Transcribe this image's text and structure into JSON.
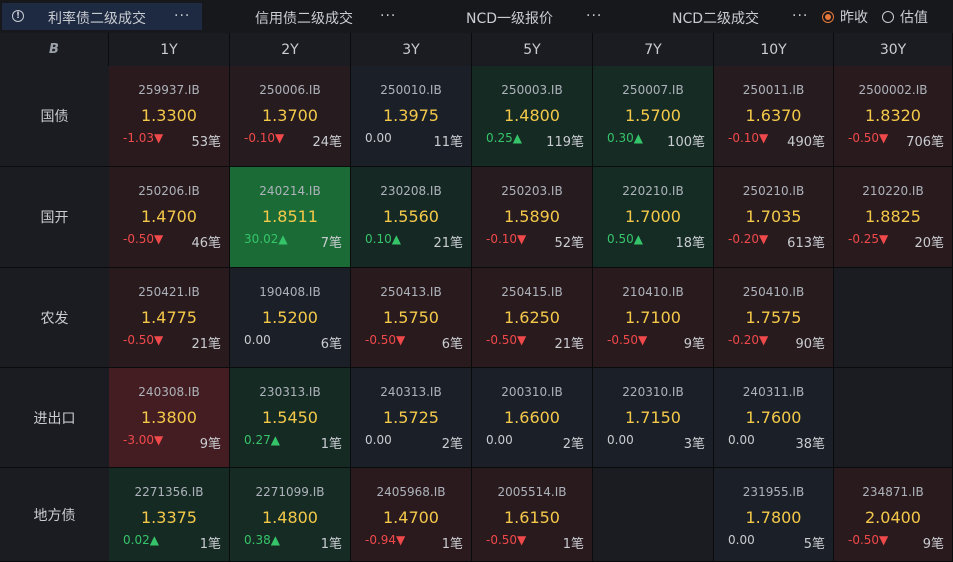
{
  "tabs": [
    {
      "label": "利率债二级成交",
      "more": "···",
      "active": true
    },
    {
      "label": "信用债二级成交",
      "more": "···",
      "active": false
    },
    {
      "label": "NCD一级报价",
      "more": "···",
      "active": false
    },
    {
      "label": "NCD二级成交",
      "more": "···",
      "active": false
    }
  ],
  "radio_options": [
    {
      "label": "昨收",
      "checked": true
    },
    {
      "label": "估值",
      "checked": false
    }
  ],
  "corner_icon": "B",
  "columns": [
    "1Y",
    "2Y",
    "3Y",
    "5Y",
    "7Y",
    "10Y",
    "30Y"
  ],
  "rows": [
    {
      "label": "国债",
      "cells": [
        {
          "code": "259937.IB",
          "yield": "1.3300",
          "change": "-1.03▼",
          "dir": "down",
          "count": "53笔",
          "bg": "#2a1a1d"
        },
        {
          "code": "250006.IB",
          "yield": "1.3700",
          "change": "-0.10▼",
          "dir": "down",
          "count": "24笔",
          "bg": "#261b1e"
        },
        {
          "code": "250010.IB",
          "yield": "1.3975",
          "change": "0.00",
          "dir": "flat",
          "count": "11笔",
          "bg": "#1b1f27"
        },
        {
          "code": "250003.IB",
          "yield": "1.4800",
          "change": "0.25▲",
          "dir": "up",
          "count": "119笔",
          "bg": "#152a23"
        },
        {
          "code": "250007.IB",
          "yield": "1.5700",
          "change": "0.30▲",
          "dir": "up",
          "count": "100笔",
          "bg": "#152b23"
        },
        {
          "code": "250011.IB",
          "yield": "1.6370",
          "change": "-0.10▼",
          "dir": "down",
          "count": "490笔",
          "bg": "#261b1e"
        },
        {
          "code": "2500002.IB",
          "yield": "1.8320",
          "change": "-0.50▼",
          "dir": "down",
          "count": "706笔",
          "bg": "#291a1d"
        }
      ]
    },
    {
      "label": "国开",
      "cells": [
        {
          "code": "250206.IB",
          "yield": "1.4700",
          "change": "-0.50▼",
          "dir": "down",
          "count": "46笔",
          "bg": "#291a1d"
        },
        {
          "code": "240214.IB",
          "yield": "1.8511",
          "change": "30.02▲",
          "dir": "up",
          "count": "7笔",
          "bg": "#1a6b35"
        },
        {
          "code": "230208.IB",
          "yield": "1.5560",
          "change": "0.10▲",
          "dir": "up",
          "count": "21笔",
          "bg": "#152823"
        },
        {
          "code": "250203.IB",
          "yield": "1.5890",
          "change": "-0.10▼",
          "dir": "down",
          "count": "52笔",
          "bg": "#261b1e"
        },
        {
          "code": "220210.IB",
          "yield": "1.7000",
          "change": "0.50▲",
          "dir": "up",
          "count": "18笔",
          "bg": "#152c24"
        },
        {
          "code": "250210.IB",
          "yield": "1.7035",
          "change": "-0.20▼",
          "dir": "down",
          "count": "613笔",
          "bg": "#271b1e"
        },
        {
          "code": "210220.IB",
          "yield": "1.8825",
          "change": "-0.25▼",
          "dir": "down",
          "count": "20笔",
          "bg": "#281a1d"
        }
      ]
    },
    {
      "label": "农发",
      "cells": [
        {
          "code": "250421.IB",
          "yield": "1.4775",
          "change": "-0.50▼",
          "dir": "down",
          "count": "21笔",
          "bg": "#291a1d"
        },
        {
          "code": "190408.IB",
          "yield": "1.5200",
          "change": "0.00",
          "dir": "flat",
          "count": "6笔",
          "bg": "#1b1f27"
        },
        {
          "code": "250413.IB",
          "yield": "1.5750",
          "change": "-0.50▼",
          "dir": "down",
          "count": "6笔",
          "bg": "#291a1d"
        },
        {
          "code": "250415.IB",
          "yield": "1.6250",
          "change": "-0.50▼",
          "dir": "down",
          "count": "21笔",
          "bg": "#291a1d"
        },
        {
          "code": "210410.IB",
          "yield": "1.7100",
          "change": "-0.50▼",
          "dir": "down",
          "count": "9笔",
          "bg": "#291a1d"
        },
        {
          "code": "250410.IB",
          "yield": "1.7575",
          "change": "-0.20▼",
          "dir": "down",
          "count": "90笔",
          "bg": "#271b1e"
        },
        null
      ]
    },
    {
      "label": "进出口",
      "cells": [
        {
          "code": "240308.IB",
          "yield": "1.3800",
          "change": "-3.00▼",
          "dir": "down",
          "count": "9笔",
          "bg": "#431d22"
        },
        {
          "code": "230313.IB",
          "yield": "1.5450",
          "change": "0.27▲",
          "dir": "up",
          "count": "1笔",
          "bg": "#152a23"
        },
        {
          "code": "240313.IB",
          "yield": "1.5725",
          "change": "0.00",
          "dir": "flat",
          "count": "2笔",
          "bg": "#1b1f27"
        },
        {
          "code": "200310.IB",
          "yield": "1.6600",
          "change": "0.00",
          "dir": "flat",
          "count": "2笔",
          "bg": "#1b1f27"
        },
        {
          "code": "220310.IB",
          "yield": "1.7150",
          "change": "0.00",
          "dir": "flat",
          "count": "3笔",
          "bg": "#1b1f27"
        },
        {
          "code": "240311.IB",
          "yield": "1.7600",
          "change": "0.00",
          "dir": "flat",
          "count": "38笔",
          "bg": "#1b1f27"
        },
        null
      ]
    },
    {
      "label": "地方债",
      "cells": [
        {
          "code": "2271356.IB",
          "yield": "1.3375",
          "change": "0.02▲",
          "dir": "up",
          "count": "1笔",
          "bg": "#152a23"
        },
        {
          "code": "2271099.IB",
          "yield": "1.4800",
          "change": "0.38▲",
          "dir": "up",
          "count": "1笔",
          "bg": "#152b23"
        },
        {
          "code": "2405968.IB",
          "yield": "1.4700",
          "change": "-0.94▼",
          "dir": "down",
          "count": "1笔",
          "bg": "#2a1a1d"
        },
        {
          "code": "2005514.IB",
          "yield": "1.6150",
          "change": "-0.50▼",
          "dir": "down",
          "count": "1笔",
          "bg": "#291a1d"
        },
        null,
        {
          "code": "231955.IB",
          "yield": "1.7800",
          "change": "0.00",
          "dir": "flat",
          "count": "5笔",
          "bg": "#1b1f27"
        },
        {
          "code": "234871.IB",
          "yield": "2.0400",
          "change": "-0.50▼",
          "dir": "down",
          "count": "9笔",
          "bg": "#291a1d"
        }
      ]
    }
  ],
  "colors": {
    "accent": "#e8773a",
    "up": "#36c46a",
    "down": "#f0494b",
    "yield": "#f4c94a",
    "empty_cell": "#1a1c21"
  }
}
